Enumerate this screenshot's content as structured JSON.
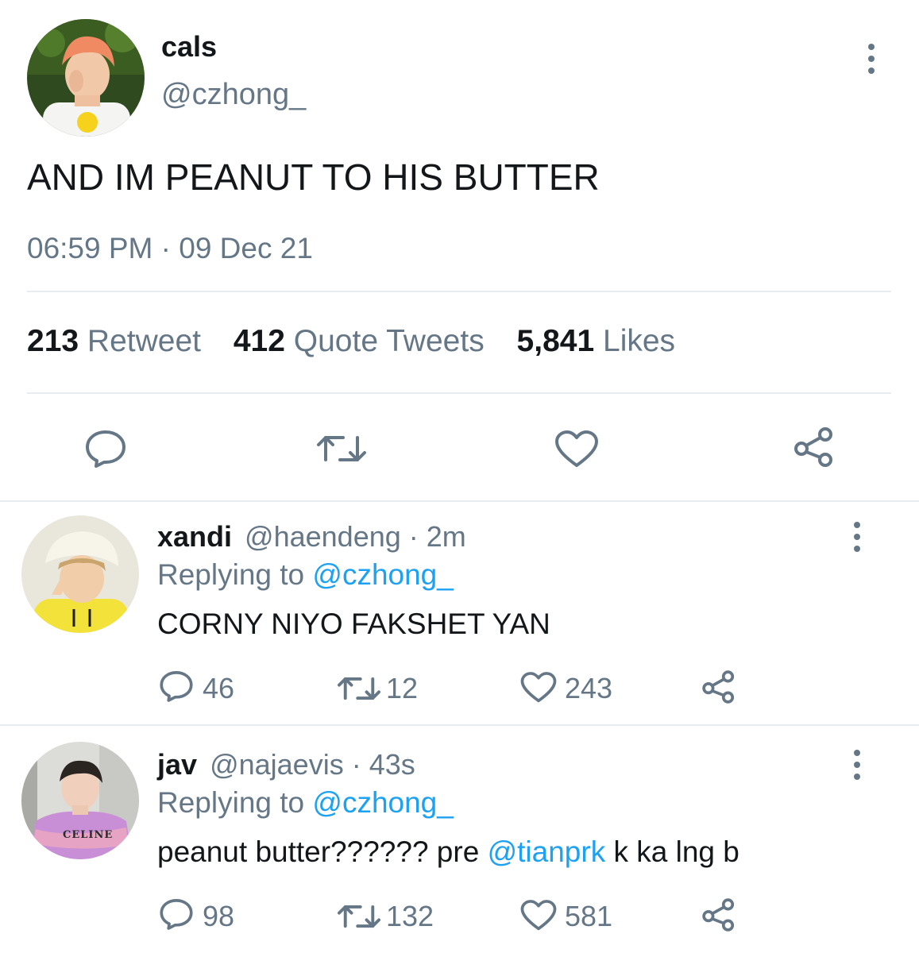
{
  "main_tweet": {
    "display_name": "cals",
    "handle": "@czhong_",
    "text": "AND IM PEANUT TO HIS BUTTER",
    "timestamp": "06:59 PM · 09 Dec 21",
    "stats": {
      "retweets_count": "213",
      "retweets_label": "Retweet",
      "quotes_count": "412",
      "quotes_label": "Quote Tweets",
      "likes_count": "5,841",
      "likes_label": "Likes"
    }
  },
  "replies": [
    {
      "display_name": "xandi",
      "handle": "@haendeng",
      "time": "· 2m",
      "replying_label": "Replying to",
      "replying_to": "@czhong_",
      "text": "CORNY NIYO FAKSHET YAN",
      "reply_count": "46",
      "retweet_count": "12",
      "like_count": "243"
    },
    {
      "display_name": "jav",
      "handle": "@najaevis",
      "time": "· 43s",
      "replying_label": "Replying to",
      "replying_to": "@czhong_",
      "text_before": "peanut butter?????? pre ",
      "mention": "@tianprk",
      "text_after": " k ka lng b",
      "reply_count": "98",
      "retweet_count": "132",
      "like_count": "581",
      "avatar_shirt_text": "CELINE"
    }
  ],
  "icons": {
    "reply": "speech-bubble-icon",
    "retweet": "retweet-arrows-icon",
    "like": "heart-icon",
    "share": "share-nodes-icon",
    "more": "vertical-dots-icon"
  },
  "colors": {
    "text": "#14171a",
    "muted": "#657786",
    "link": "#1da1f2",
    "divider": "#e6ecf0"
  }
}
